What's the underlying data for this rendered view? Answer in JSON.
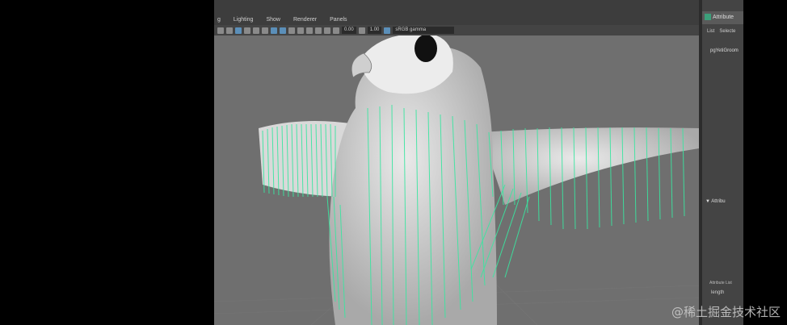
{
  "menu": [
    "g",
    "Lighting",
    "Show",
    "Renderer",
    "Panels"
  ],
  "toolbar": {
    "field1": "0.00",
    "field2": "1.00",
    "colorspace": "sRGB gamma"
  },
  "attribute_editor": {
    "title": "Attribute",
    "tabs": [
      "List",
      "Selecte"
    ],
    "node_name": "pgYetiGroom",
    "section": "Attribu",
    "list_label": "Attribute List",
    "length_label": "length"
  },
  "watermark": "@稀土掘金技术社区"
}
